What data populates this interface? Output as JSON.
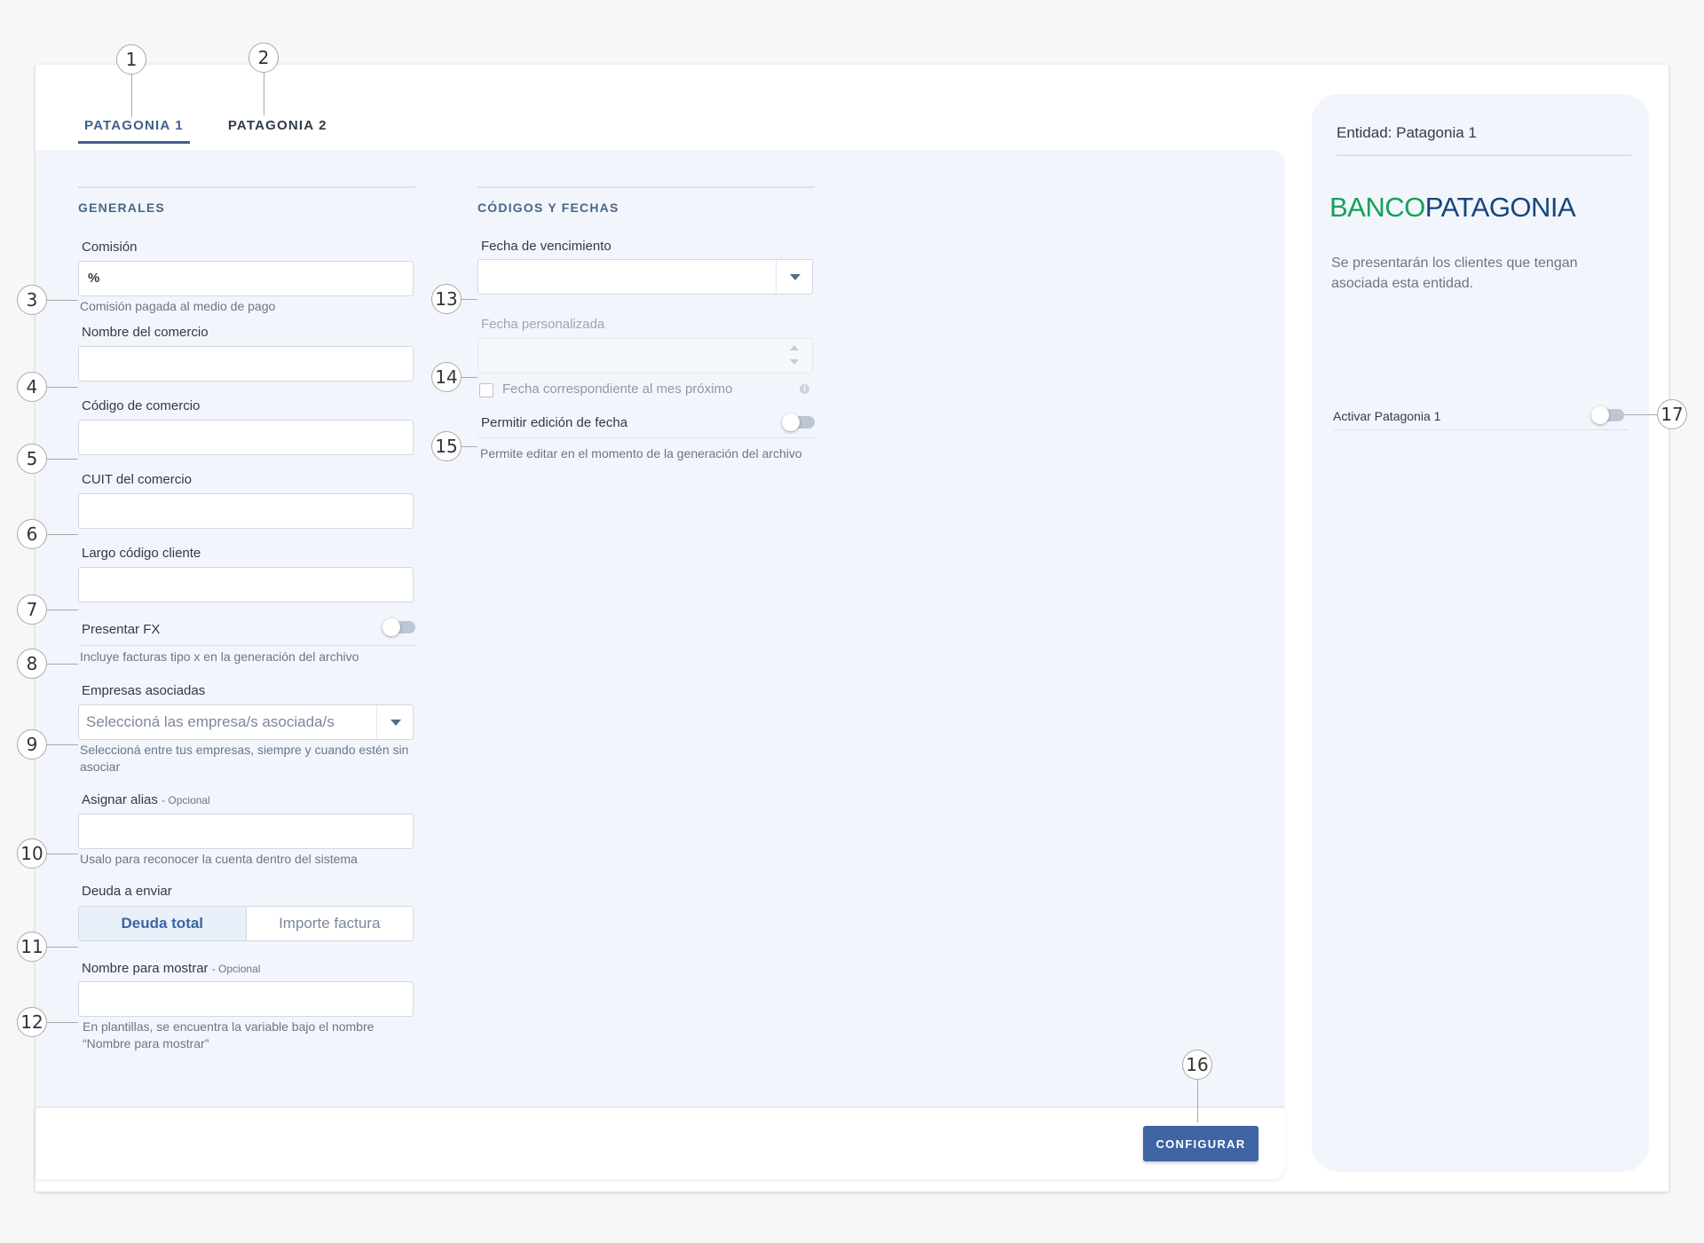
{
  "tabs": [
    {
      "label": "PATAGONIA 1",
      "active": true
    },
    {
      "label": "PATAGONIA 2",
      "active": false
    }
  ],
  "generales": {
    "title": "GENERALES",
    "comision": {
      "label": "Comisión",
      "prefix": "%",
      "value": "",
      "help": "Comisión pagada al medio de pago"
    },
    "nombre_comercio": {
      "label": "Nombre del comercio",
      "value": ""
    },
    "codigo_comercio": {
      "label": "Código de comercio",
      "value": ""
    },
    "cuit_comercio": {
      "label": "CUIT del comercio",
      "value": ""
    },
    "largo_codigo": {
      "label": "Largo código cliente",
      "value": ""
    },
    "presentar_fx": {
      "label": "Presentar FX",
      "enabled": false,
      "help": "Incluye facturas tipo x en la generación del archivo"
    },
    "empresas": {
      "label": "Empresas asociadas",
      "placeholder": "Seleccioná las empresa/s asociada/s",
      "help": "Seleccioná entre tus empresas, siempre y cuando estén sin asociar"
    },
    "alias": {
      "label": "Asignar alias",
      "optional": "- Opcional",
      "value": "",
      "help": "Usalo para reconocer la cuenta dentro del sistema"
    },
    "deuda": {
      "label": "Deuda a enviar",
      "options": [
        "Deuda total",
        "Importe factura"
      ],
      "selected": "Deuda total"
    },
    "nombre_mostrar": {
      "label": "Nombre para mostrar",
      "optional": "- Opcional",
      "value": "",
      "help": "En plantillas, se encuentra la variable bajo el nombre “Nombre para mostrar”"
    }
  },
  "codigos": {
    "title": "CÓDIGOS Y FECHAS",
    "vencimiento": {
      "label": "Fecha de vencimiento",
      "value": ""
    },
    "personalizada": {
      "label": "Fecha personalizada",
      "value": ""
    },
    "mes_proximo": {
      "label": "Fecha correspondiente al mes próximo",
      "checked": false
    },
    "edicion": {
      "label": "Permitir edición de fecha",
      "enabled": false,
      "help": "Permite editar en el momento de la generación del archivo"
    }
  },
  "footer": {
    "configure_label": "CONFIGURAR"
  },
  "side": {
    "title": "Entidad: Patagonia 1",
    "logo_part1": "BANCO",
    "logo_part2": "PATAGONIA",
    "description": "Se presentarán los clientes que tengan asociada esta entidad.",
    "activate_label": "Activar Patagonia 1",
    "activate_enabled": false
  },
  "callouts": [
    "1",
    "2",
    "3",
    "4",
    "5",
    "6",
    "7",
    "8",
    "9",
    "10",
    "11",
    "12",
    "13",
    "14",
    "15",
    "16",
    "17"
  ],
  "colors": {
    "accent": "#3f64a4",
    "logo_green": "#16a05a",
    "logo_blue": "#16467f",
    "panel": "#f2f6fc"
  }
}
